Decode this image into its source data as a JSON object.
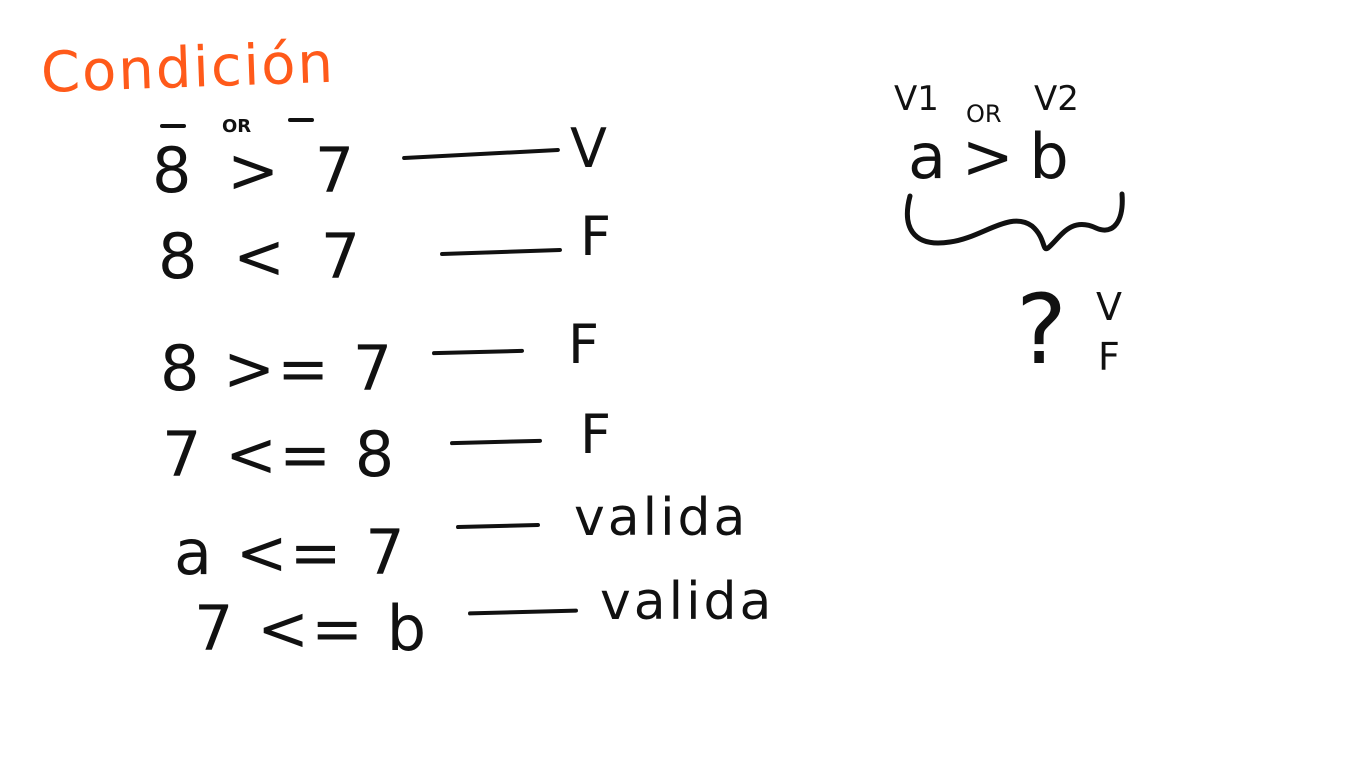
{
  "title": "Condición",
  "rows": [
    {
      "expression": "8 > 7",
      "result": "V"
    },
    {
      "expression": "8 < 7",
      "result": "F"
    },
    {
      "expression": "8 >= 7",
      "result": "F"
    },
    {
      "expression": "7 <= 8",
      "result": "F"
    },
    {
      "expression": "a <= 7",
      "result": "valida"
    },
    {
      "expression": "7 <= b",
      "result": "valida"
    }
  ],
  "first_row_or_label": "OR",
  "diagram": {
    "v1": "V1",
    "or": "OR",
    "v2": "V2",
    "expression": "a > b",
    "question": "?",
    "true_label": "V",
    "false_label": "F"
  },
  "colors": {
    "ink": "#111111",
    "title": "#ff5a1a",
    "background": "#ffffff"
  }
}
